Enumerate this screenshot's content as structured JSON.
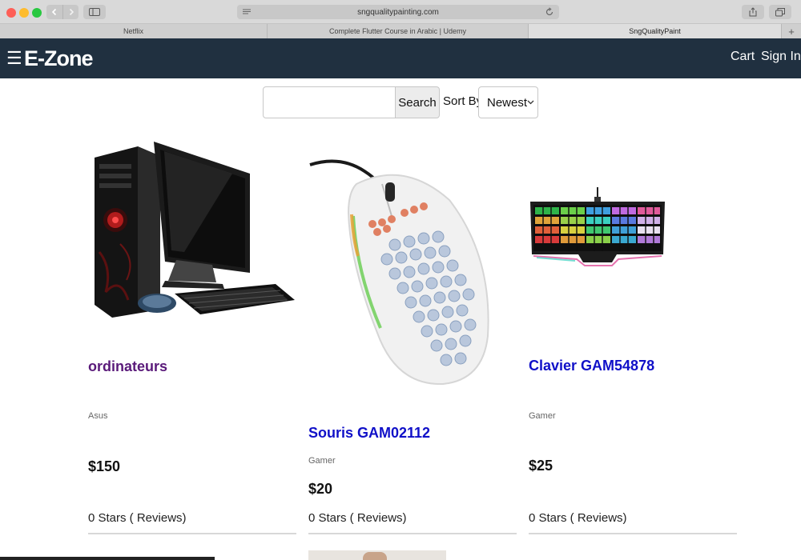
{
  "browser": {
    "url": "sngqualitypainting.com",
    "tabs": [
      {
        "label": "Netflix"
      },
      {
        "label": "Complete Flutter Course in Arabic | Udemy"
      },
      {
        "label": "SngQualityPaint"
      }
    ],
    "new_tab_label": "+"
  },
  "appbar": {
    "menu_glyph": "☰",
    "brand": "E-Zone",
    "cart_label": "Cart",
    "signin_label": "Sign In"
  },
  "search": {
    "value": "",
    "placeholder": "",
    "button_label": "Search",
    "sort_label": "Sort By",
    "sort_selected": "Newest"
  },
  "products": [
    {
      "name": "ordinateurs",
      "brand": "Asus",
      "price": "$150",
      "reviews": "0 Stars ( Reviews)",
      "image": "desktop-computer-image",
      "visited": true
    },
    {
      "name": "Souris GAM02112",
      "brand": "Gamer",
      "price": "$20",
      "reviews": "0 Stars ( Reviews)",
      "image": "gaming-mouse-image",
      "visited": false
    },
    {
      "name": "Clavier GAM54878",
      "brand": "Gamer",
      "price": "$25",
      "reviews": "0 Stars ( Reviews)",
      "image": "gaming-keyboard-image",
      "visited": false
    }
  ],
  "colors": {
    "navbar": "#203040",
    "link": "#1010c8",
    "visited_link": "#5a1a7a"
  }
}
